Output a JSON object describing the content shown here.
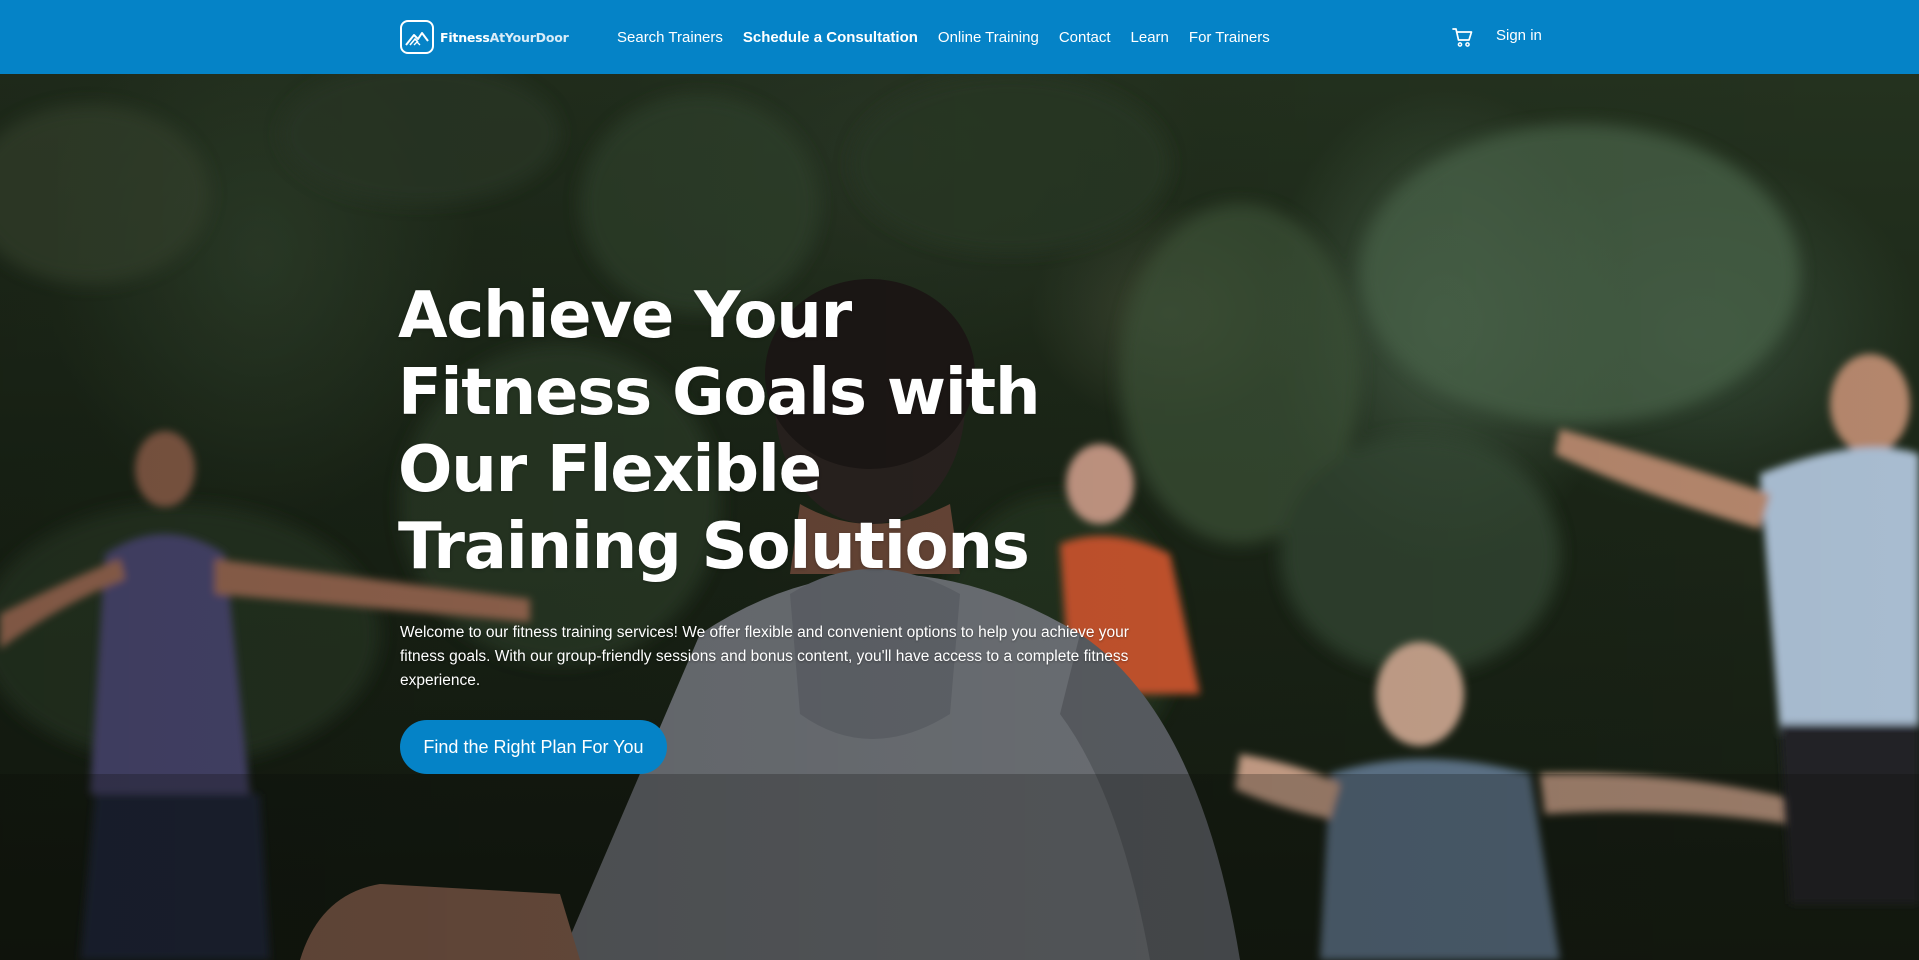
{
  "header": {
    "logo": {
      "name_bold": "Fitness",
      "name_light": "AtYourDoor"
    },
    "nav": [
      {
        "label": "Search Trainers"
      },
      {
        "label": "Schedule a Consultation",
        "active": true
      },
      {
        "label": "Online Training"
      },
      {
        "label": "Contact"
      },
      {
        "label": "Learn"
      },
      {
        "label": "For Trainers"
      }
    ],
    "cart_icon": "shopping-cart-icon",
    "sign_in": "Sign in"
  },
  "hero": {
    "title": "Achieve Your Fitness Goals with Our Flexible Training Solutions",
    "subtitle": "Welcome to our fitness training services! We offer flexible and convenient options to help you achieve your fitness goals. With our group-friendly sessions and bonus content, you'll have access to a complete fitness experience.",
    "cta": "Find the Right Plan For You"
  },
  "colors": {
    "brand": "#0583c7",
    "text_on_brand": "#ffffff"
  }
}
